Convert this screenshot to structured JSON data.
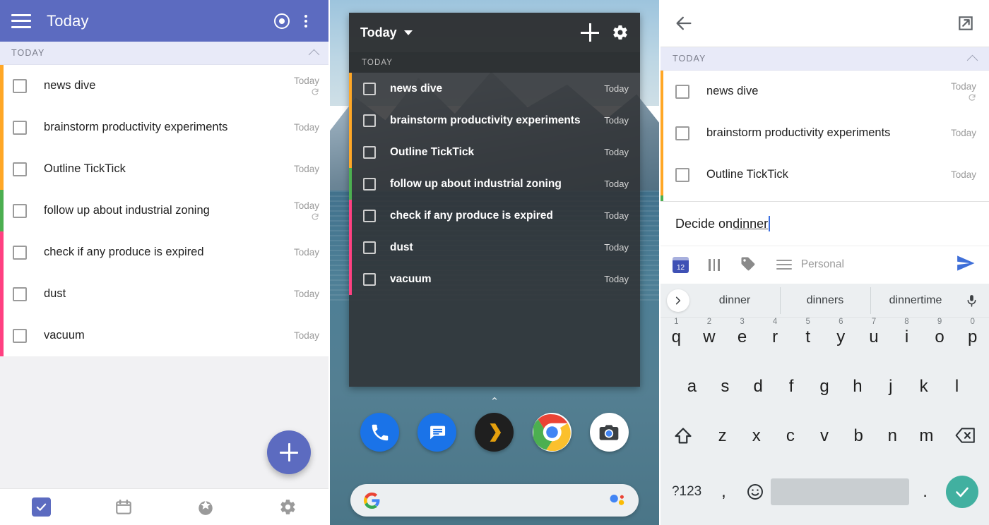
{
  "colors": {
    "accent_indigo": "#5c6bc0",
    "stripe_orange": "#ffa726",
    "stripe_green": "#4caf50",
    "stripe_pink": "#ff4081",
    "section_bg": "#e8eaf8",
    "keyboard_bg": "#eceff1",
    "enter_teal": "#41b0a0",
    "caret_blue": "#3b6fe0"
  },
  "left_panel": {
    "appbar": {
      "menu_icon": "hamburger-icon",
      "title": "Today",
      "focus_icon": "target-icon",
      "overflow_icon": "more-vertical-icon"
    },
    "section": {
      "label": "TODAY",
      "collapse_icon": "chevron-up-icon"
    },
    "tasks": [
      {
        "title": "news dive",
        "date": "Today",
        "stripe": "#ffa726",
        "repeat": true
      },
      {
        "title": "brainstorm productivity experiments",
        "date": "Today",
        "stripe": "#ffa726",
        "repeat": false
      },
      {
        "title": "Outline TickTick",
        "date": "Today",
        "stripe": "#ffa726",
        "repeat": false
      },
      {
        "title": "follow up about industrial zoning",
        "date": "Today",
        "stripe": "#4caf50",
        "repeat": true
      },
      {
        "title": "check if any produce is expired",
        "date": "Today",
        "stripe": "#ff4081",
        "repeat": false
      },
      {
        "title": "dust",
        "date": "Today",
        "stripe": "#ff4081",
        "repeat": false
      },
      {
        "title": "vacuum",
        "date": "Today",
        "stripe": "#ff4081",
        "repeat": false
      }
    ],
    "fab": {
      "icon": "plus-icon",
      "label": "Add task"
    },
    "bottom_nav": [
      {
        "name": "tasks",
        "icon": "checkbox-checked-icon",
        "active": true
      },
      {
        "name": "calendar",
        "icon": "calendar-icon",
        "active": false
      },
      {
        "name": "pomodoro",
        "icon": "crown-icon",
        "active": false
      },
      {
        "name": "settings",
        "icon": "gear-icon",
        "active": false
      }
    ]
  },
  "mid_panel": {
    "widget": {
      "title": "Today",
      "caret_icon": "caret-down-icon",
      "add_icon": "plus-icon",
      "settings_icon": "gear-icon",
      "section_label": "TODAY",
      "tasks": [
        {
          "title": "news dive",
          "date": "Today",
          "stripe": "#ffa726"
        },
        {
          "title": "brainstorm productivity experiments",
          "date": "Today",
          "stripe": "#ffa726"
        },
        {
          "title": "Outline TickTick",
          "date": "Today",
          "stripe": "#ffa726"
        },
        {
          "title": "follow up about industrial zoning",
          "date": "Today",
          "stripe": "#4caf50"
        },
        {
          "title": "check if any produce is expired",
          "date": "Today",
          "stripe": "#ff4081"
        },
        {
          "title": "dust",
          "date": "Today",
          "stripe": "#ff4081"
        },
        {
          "title": "vacuum",
          "date": "Today",
          "stripe": "#ff4081"
        }
      ]
    },
    "home_chevron_icon": "chevron-up-icon",
    "dock": [
      {
        "name": "phone",
        "icon": "phone-icon"
      },
      {
        "name": "messages",
        "icon": "message-icon"
      },
      {
        "name": "plex",
        "icon": "plex-chevron-icon"
      },
      {
        "name": "chrome",
        "icon": "chrome-icon"
      },
      {
        "name": "camera",
        "icon": "camera-icon"
      }
    ],
    "search_bar": {
      "google_icon": "google-g-icon",
      "assistant_icon": "google-assistant-icon",
      "placeholder": ""
    }
  },
  "right_panel": {
    "toolbar": {
      "back_icon": "back-arrow-icon",
      "expand_icon": "open-in-new-icon"
    },
    "section": {
      "label": "TODAY",
      "collapse_icon": "chevron-up-icon"
    },
    "tasks": [
      {
        "title": "news dive",
        "date": "Today",
        "stripe": "#ffa726",
        "repeat": true
      },
      {
        "title": "brainstorm productivity experiments",
        "date": "Today",
        "stripe": "#ffa726",
        "repeat": false
      },
      {
        "title": "Outline TickTick",
        "date": "Today",
        "stripe": "#ffa726",
        "repeat": false
      }
    ],
    "compose": {
      "text_before": "Decide on ",
      "text_spellchecked": "dinner",
      "tools": {
        "date_icon": "calendar-icon",
        "date_day": "12",
        "priority_icon": "priority-flag-icon",
        "tag_icon": "tag-icon",
        "list_icon": "list-lines-icon",
        "list_name": "Personal",
        "send_icon": "send-icon"
      }
    },
    "keyboard": {
      "expand_icon": "chevron-right-icon",
      "suggestions": [
        "dinner",
        "dinners",
        "dinnertime"
      ],
      "mic_icon": "microphone-icon",
      "row1": [
        {
          "key": "q",
          "num": "1"
        },
        {
          "key": "w",
          "num": "2"
        },
        {
          "key": "e",
          "num": "3"
        },
        {
          "key": "r",
          "num": "4"
        },
        {
          "key": "t",
          "num": "5"
        },
        {
          "key": "y",
          "num": "6"
        },
        {
          "key": "u",
          "num": "7"
        },
        {
          "key": "i",
          "num": "8"
        },
        {
          "key": "o",
          "num": "9"
        },
        {
          "key": "p",
          "num": "0"
        }
      ],
      "row2": [
        "a",
        "s",
        "d",
        "f",
        "g",
        "h",
        "j",
        "k",
        "l"
      ],
      "row3": [
        "z",
        "x",
        "c",
        "v",
        "b",
        "n",
        "m"
      ],
      "shift_icon": "shift-up-icon",
      "backspace_icon": "backspace-icon",
      "symbols_key": "?123",
      "comma_key": ",",
      "emoji_icon": "emoji-smiley-icon",
      "period_key": ".",
      "enter_icon": "check-icon"
    }
  }
}
